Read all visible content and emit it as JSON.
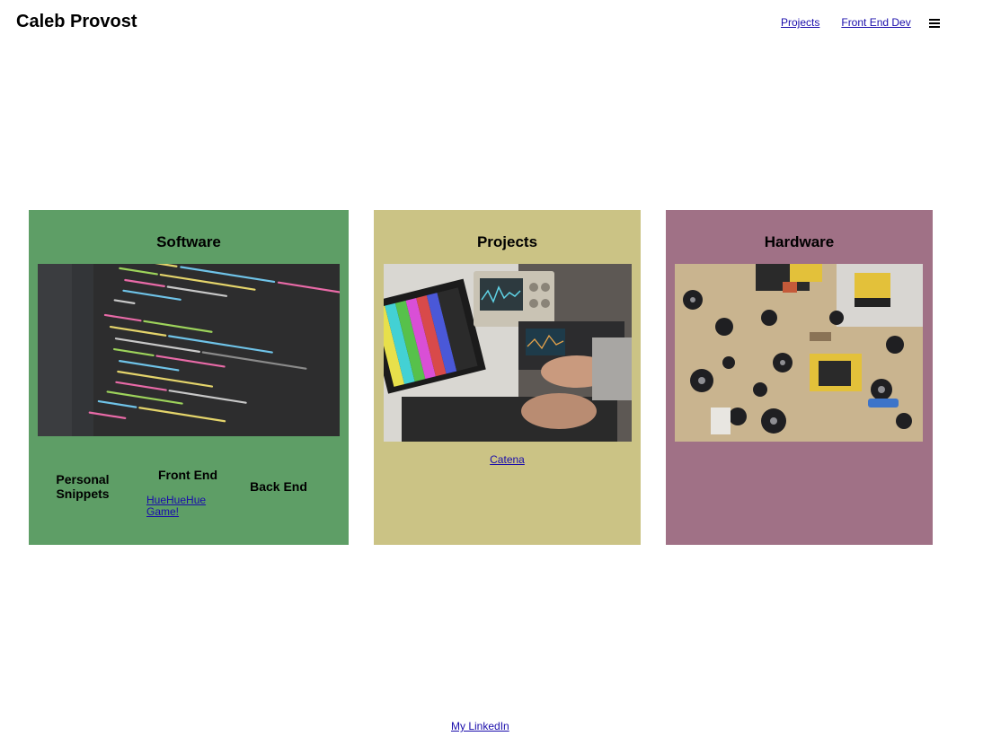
{
  "header": {
    "site_title": "Caleb Provost",
    "nav_links": [
      "Projects",
      "Front End Dev"
    ],
    "menu_icon": "hamburger-menu-icon"
  },
  "cards": {
    "software": {
      "title": "Software",
      "color": "#5e9e66",
      "image": "code-editor-photo",
      "columns": {
        "personal_snippets": "Personal Snippets",
        "front_end": "Front End",
        "front_end_link": "HueHueHue Game!",
        "back_end": "Back End"
      }
    },
    "projects": {
      "title": "Projects",
      "color": "#cbc385",
      "image": "oscilloscope-workbench-photo",
      "link": "Catena"
    },
    "hardware": {
      "title": "Hardware",
      "color": "#a07186",
      "image": "circuit-board-components-photo"
    }
  },
  "footer": {
    "link": "My LinkedIn"
  }
}
